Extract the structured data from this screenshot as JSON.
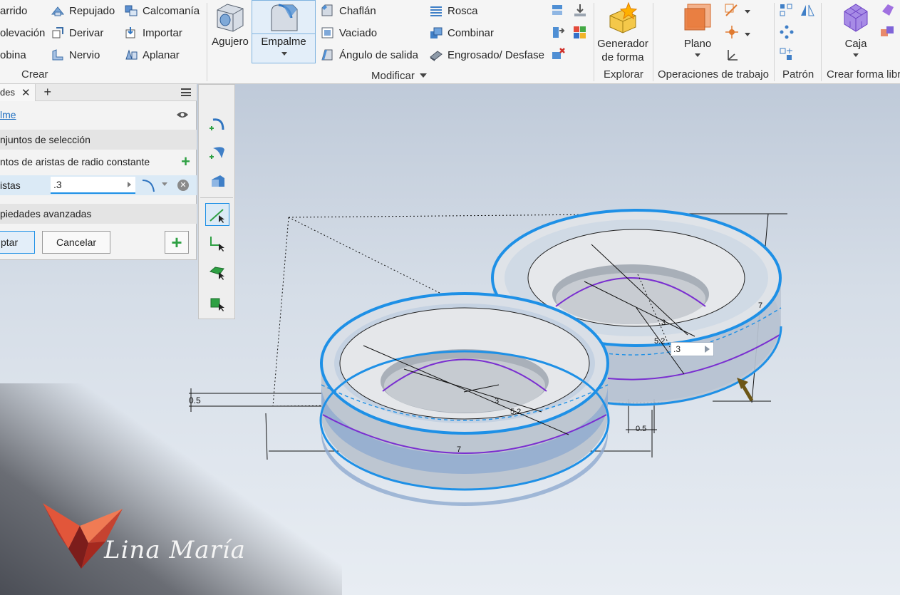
{
  "ribbon": {
    "crear": {
      "items": [
        "arrido",
        "olevación",
        "obina",
        "Repujado",
        "Derivar",
        "Nervio",
        "Calcomanía",
        "Importar",
        "Aplanar"
      ],
      "label": "Crear"
    },
    "modificar": {
      "agujero": "Agujero",
      "empalme": "Empalme",
      "items": [
        "Chaflán",
        "Vaciado",
        "Ángulo de salida",
        "Rosca",
        "Combinar",
        "Engrosado/ Desfase"
      ],
      "label": "Modificar"
    },
    "explorar": {
      "generador_line1": "Generador",
      "generador_line2": "de forma",
      "label": "Explorar"
    },
    "operaciones": {
      "plano": "Plano",
      "label": "Operaciones de trabajo"
    },
    "patron": {
      "label": "Patrón"
    },
    "forma_libre": {
      "caja": "Caja",
      "label": "Crear forma libr"
    }
  },
  "panel": {
    "tab_label": "des",
    "feature_name": "lme",
    "section_selection": "njuntos de selección",
    "constant_radius": "ntos de aristas de radio constante",
    "edges_label": "istas",
    "radius_value": ".3",
    "section_advanced": "piedades avanzadas",
    "accept_label": "ptar",
    "cancel_label": "Cancelar"
  },
  "viewport": {
    "radius_input": ".3",
    "dims": {
      "d_0_5_left": "0.5",
      "d_0_5_right": "0.5",
      "d_3_front": "3",
      "d_5_2_front": "5.2",
      "d_7_front": "7",
      "d_3_back": "3",
      "d_5_2_back": "5.2",
      "d_7_back": "7"
    },
    "watermark": "Lina María"
  },
  "colors": {
    "accent": "#1e90e6",
    "selection_blue": "#2b9ae8",
    "purple_edge": "#7a2fd0",
    "add_green": "#2ea043"
  }
}
